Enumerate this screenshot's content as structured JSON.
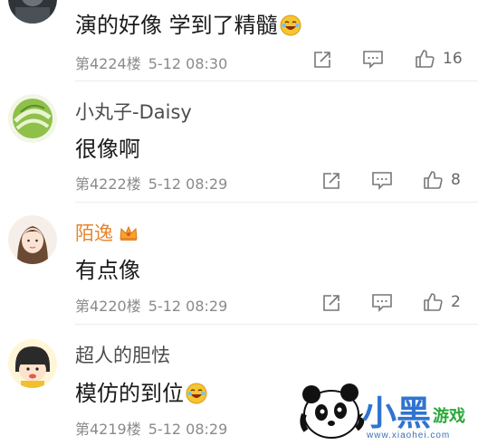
{
  "comments": [
    {
      "text": "演的好像  学到了精髓",
      "floor": "第4224楼",
      "time": "5-12 08:30",
      "likes": "16"
    },
    {
      "user": "小丸子-Daisy",
      "text": "很像啊",
      "floor": "第4222楼",
      "time": "5-12 08:29",
      "likes": "8"
    },
    {
      "user": "陌逸",
      "text": "有点像",
      "floor": "第4220楼",
      "time": "5-12 08:29",
      "likes": "2"
    },
    {
      "user": "超人的胆怯",
      "text": "模仿的到位",
      "floor": "第4219楼",
      "time": "5-12 08:29"
    }
  ],
  "watermark": {
    "title": "小黑",
    "subtitle": "游戏",
    "site": "www.xiaohei.com"
  },
  "icons": {
    "share": "share-icon",
    "reply": "comment-icon",
    "like": "thumbs-up-icon",
    "vip": "crown-icon",
    "emoji": "laughing-emoji-icon"
  },
  "colors": {
    "vip_name": "#e8842a",
    "meta": "#8a8a8a",
    "watermark_blue": "#2f74d0",
    "watermark_green": "#2aa83a"
  }
}
